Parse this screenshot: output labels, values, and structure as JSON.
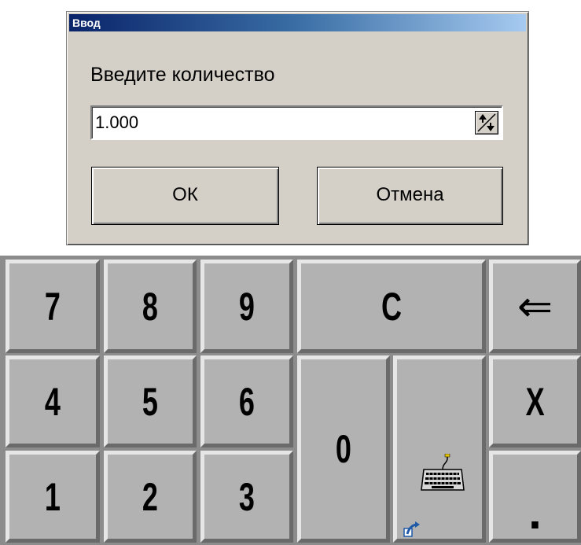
{
  "dialog": {
    "title": "Ввод",
    "prompt": "Введите количество",
    "quantity_value": "1.000",
    "ok_label": "ОК",
    "cancel_label": "Отмена"
  },
  "keypad": {
    "keys": {
      "k7": "7",
      "k8": "8",
      "k9": "9",
      "clear": "C",
      "backspace": "⇐",
      "k4": "4",
      "k5": "5",
      "k6": "6",
      "k0": "0",
      "close": "X",
      "k1": "1",
      "k2": "2",
      "k3": "3",
      "dot": "."
    },
    "icons": {
      "keyboard": "keyboard-icon",
      "layout_switch": "layout-switch-icon",
      "spin": "spin-updown-icon"
    }
  },
  "colors": {
    "title_gradient_start": "#0a246a",
    "title_gradient_end": "#a6caf0",
    "dialog_face": "#d4d0c8",
    "key_face": "#b2b2b2"
  }
}
